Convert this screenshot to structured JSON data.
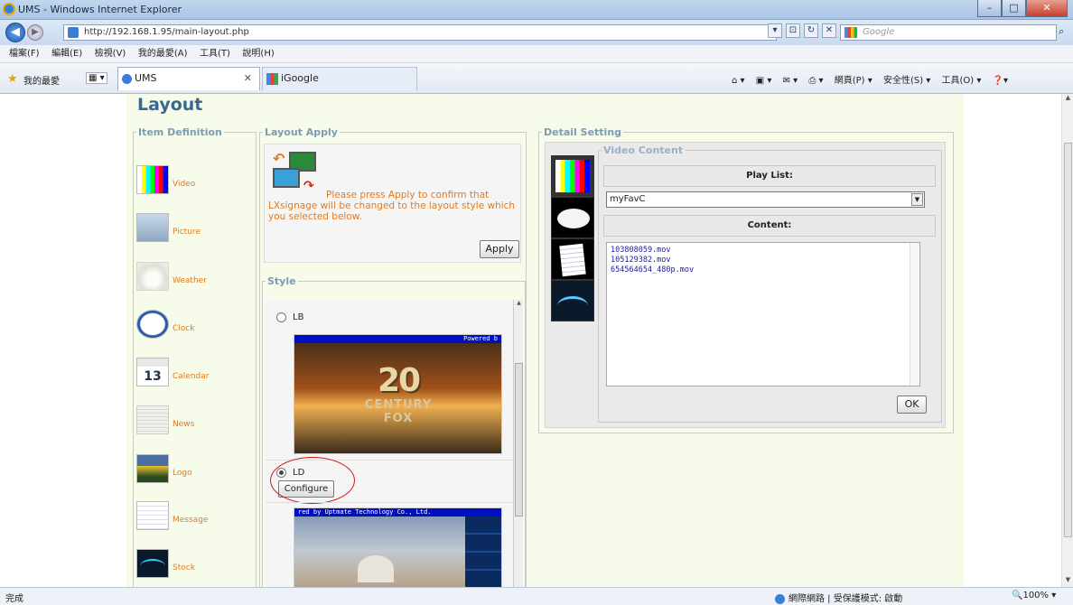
{
  "window": {
    "title": "UMS - Windows Internet Explorer",
    "min": "–",
    "max": "□",
    "close": "✕"
  },
  "address": {
    "url": "http://192.168.1.95/main-layout.php",
    "search_placeholder": "Google"
  },
  "menu": [
    "檔案(F)",
    "編輯(E)",
    "檢視(V)",
    "我的最愛(A)",
    "工具(T)",
    "說明(H)"
  ],
  "favorites": {
    "label": "我的最愛",
    "tab_ums": "UMS",
    "tab_google": "iGoogle",
    "tab_close": "✕"
  },
  "command_bar": [
    "網頁(P) ▾",
    "安全性(S) ▾",
    "工具(O) ▾"
  ],
  "page": {
    "title": "Layout",
    "item_definition": {
      "legend": "Item Definition",
      "items": [
        {
          "label": "Video",
          "icon": "video-icon"
        },
        {
          "label": "Picture",
          "icon": "picture-icon"
        },
        {
          "label": "Weather",
          "icon": "weather-icon"
        },
        {
          "label": "Clock",
          "icon": "clock-icon"
        },
        {
          "label": "Calendar",
          "icon": "calendar-icon",
          "icon_text": "13"
        },
        {
          "label": "News",
          "icon": "news-icon"
        },
        {
          "label": "Logo",
          "icon": "logo-icon"
        },
        {
          "label": "Message",
          "icon": "message-icon"
        },
        {
          "label": "Stock",
          "icon": "stock-icon"
        }
      ]
    },
    "layout_apply": {
      "legend": "Layout Apply",
      "message": "Please press Apply to confirm that LXsignage will be changed to the layout style which you selected below.",
      "apply_label": "Apply"
    },
    "style": {
      "legend": "Style",
      "options": [
        {
          "label": "LB",
          "selected": false,
          "banner": "Powered b",
          "art": "20",
          "art_sub": "CENTURY FOX"
        },
        {
          "label": "LD",
          "selected": true,
          "banner": "red by Uptmate Technology Co., Ltd."
        }
      ],
      "configure_label": "Configure"
    },
    "detail": {
      "legend": "Detail Setting",
      "video_content_legend": "Video Content",
      "playlist_header": "Play List:",
      "playlist_value": "myFavC",
      "content_header": "Content:",
      "content_files": [
        "103808059.mov",
        "105129382.mov",
        "654564654_480p.mov"
      ],
      "ok_label": "OK"
    }
  },
  "status": {
    "text": "完成",
    "zone": "網際網路 | 受保護模式: 啟動",
    "zoom": "🔍100% ▾"
  },
  "colors": {
    "accent_orange": "#e07b22",
    "title_blue": "#356a8e",
    "legend_blue": "#7d9bb3",
    "page_bg": "#f6fbea",
    "highlight_red": "#d01818"
  }
}
